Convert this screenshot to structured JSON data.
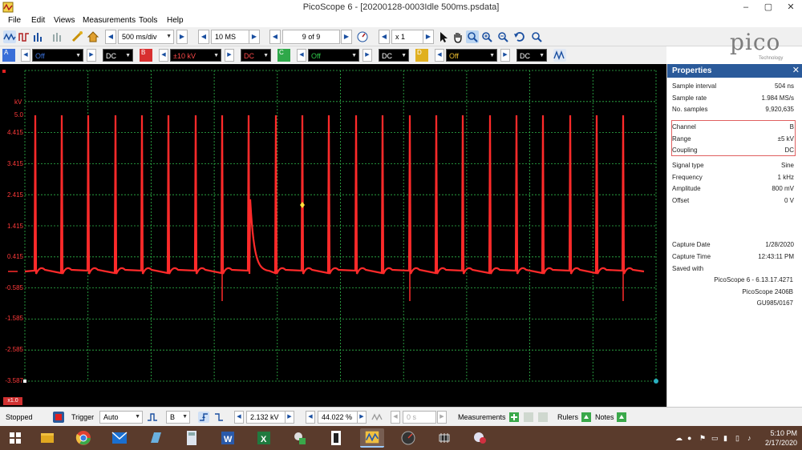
{
  "window": {
    "title": "PicoScope 6 - [20200128-0003Idle 500ms.psdata]",
    "min_label": "–",
    "max_label": "▢",
    "close_label": "✕"
  },
  "menu": {
    "items": [
      "File",
      "Edit",
      "Views",
      "Measurements",
      "Tools",
      "Help"
    ]
  },
  "toolbar": {
    "timebase": "500 ms/div",
    "samples": "10 MS",
    "buffer": "9 of 9",
    "zoom": "x 1"
  },
  "channels": [
    {
      "letter": "A",
      "range": "Off",
      "coupling": "DC",
      "color": "#3a6fd8"
    },
    {
      "letter": "B",
      "range": "±10 kV",
      "coupling": "DC",
      "color": "#d83030"
    },
    {
      "letter": "C",
      "range": "Off",
      "coupling": "DC",
      "color": "#2fa84a"
    },
    {
      "letter": "D",
      "range": "Off",
      "coupling": "DC",
      "color": "#e0b020"
    }
  ],
  "logo": {
    "brand": "pico",
    "sub": "Technology"
  },
  "scope": {
    "unit": "kV",
    "y_labels": [
      "5.0",
      "4.415",
      "3.415",
      "2.415",
      "1.415",
      "0.415",
      "-0.585",
      "-1.585",
      "-2.585",
      "-3.587"
    ],
    "zoom_tag": "x1.0",
    "trace_color": "#ff2a2a",
    "grid_color": "#2fb84a"
  },
  "properties": {
    "title": "Properties",
    "close": "✕",
    "rows": [
      {
        "k": "Sample interval",
        "v": "504 ns"
      },
      {
        "k": "Sample rate",
        "v": "1.984 MS/s"
      },
      {
        "k": "No. samples",
        "v": "9,920,635"
      }
    ],
    "channel_rows": [
      {
        "k": "Channel",
        "v": "B"
      },
      {
        "k": "Range",
        "v": "±5 kV"
      },
      {
        "k": "Coupling",
        "v": "DC"
      }
    ],
    "signal_rows": [
      {
        "k": "Signal type",
        "v": "Sine"
      },
      {
        "k": "Frequency",
        "v": "1 kHz"
      },
      {
        "k": "Amplitude",
        "v": "800 mV"
      },
      {
        "k": "Offset",
        "v": "0 V"
      }
    ],
    "capture_rows": [
      {
        "k": "Capture Date",
        "v": "1/28/2020"
      },
      {
        "k": "Capture Time",
        "v": "12:43:11 PM"
      }
    ],
    "saved_label": "Saved with",
    "saved_lines": [
      "PicoScope 6 - 6.13.17.4271",
      "PicoScope 2406B",
      "GU985/0167"
    ]
  },
  "statusbar": {
    "stopped": "Stopped",
    "trigger": "Trigger",
    "trigger_mode": "Auto",
    "trigger_channel": "B",
    "trigger_level": "2.132 kV",
    "pretrigger": "44.022 %",
    "delay": "0 s",
    "measurements": "Measurements",
    "rulers": "Rulers",
    "notes": "Notes"
  },
  "taskbar": {
    "time": "5:10 PM",
    "date": "2/17/2020"
  }
}
